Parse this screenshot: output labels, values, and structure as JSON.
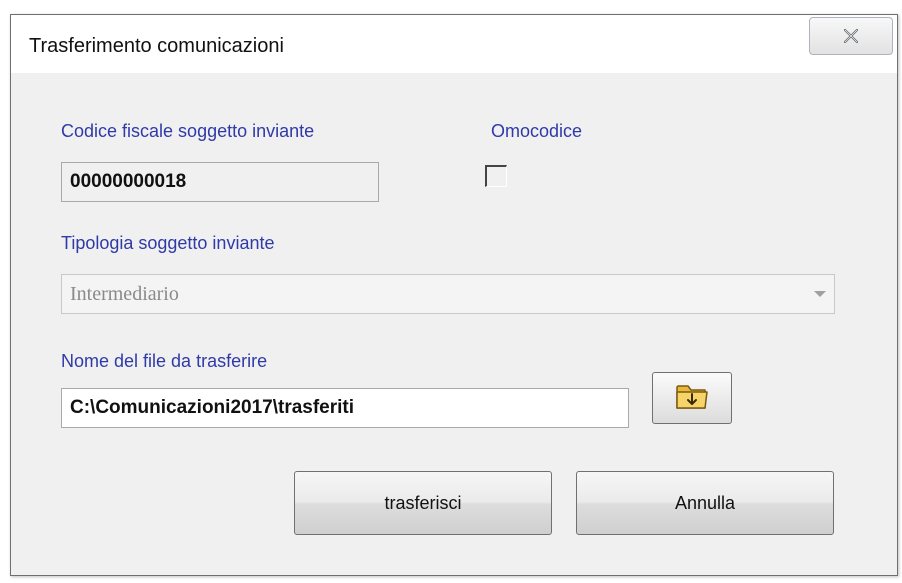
{
  "window": {
    "title": "Trasferimento comunicazioni"
  },
  "form": {
    "codice_fiscale_label": "Codice fiscale soggetto inviante",
    "codice_fiscale_value": "00000000018",
    "omocodice_label": "Omocodice",
    "omocodice_checked": false,
    "tipologia_label": "Tipologia soggetto inviante",
    "tipologia_value": "Intermediario",
    "nome_file_label": "Nome del file da trasferire",
    "nome_file_value": "C:\\Comunicazioni2017\\trasferiti"
  },
  "buttons": {
    "transfer_label": "trasferisci",
    "cancel_label": "Annulla"
  },
  "icons": {
    "close": "close-icon",
    "browse": "folder-import-icon"
  },
  "colors": {
    "label_blue": "#2f3aa8",
    "folder_yellow": "#f5c84a"
  }
}
